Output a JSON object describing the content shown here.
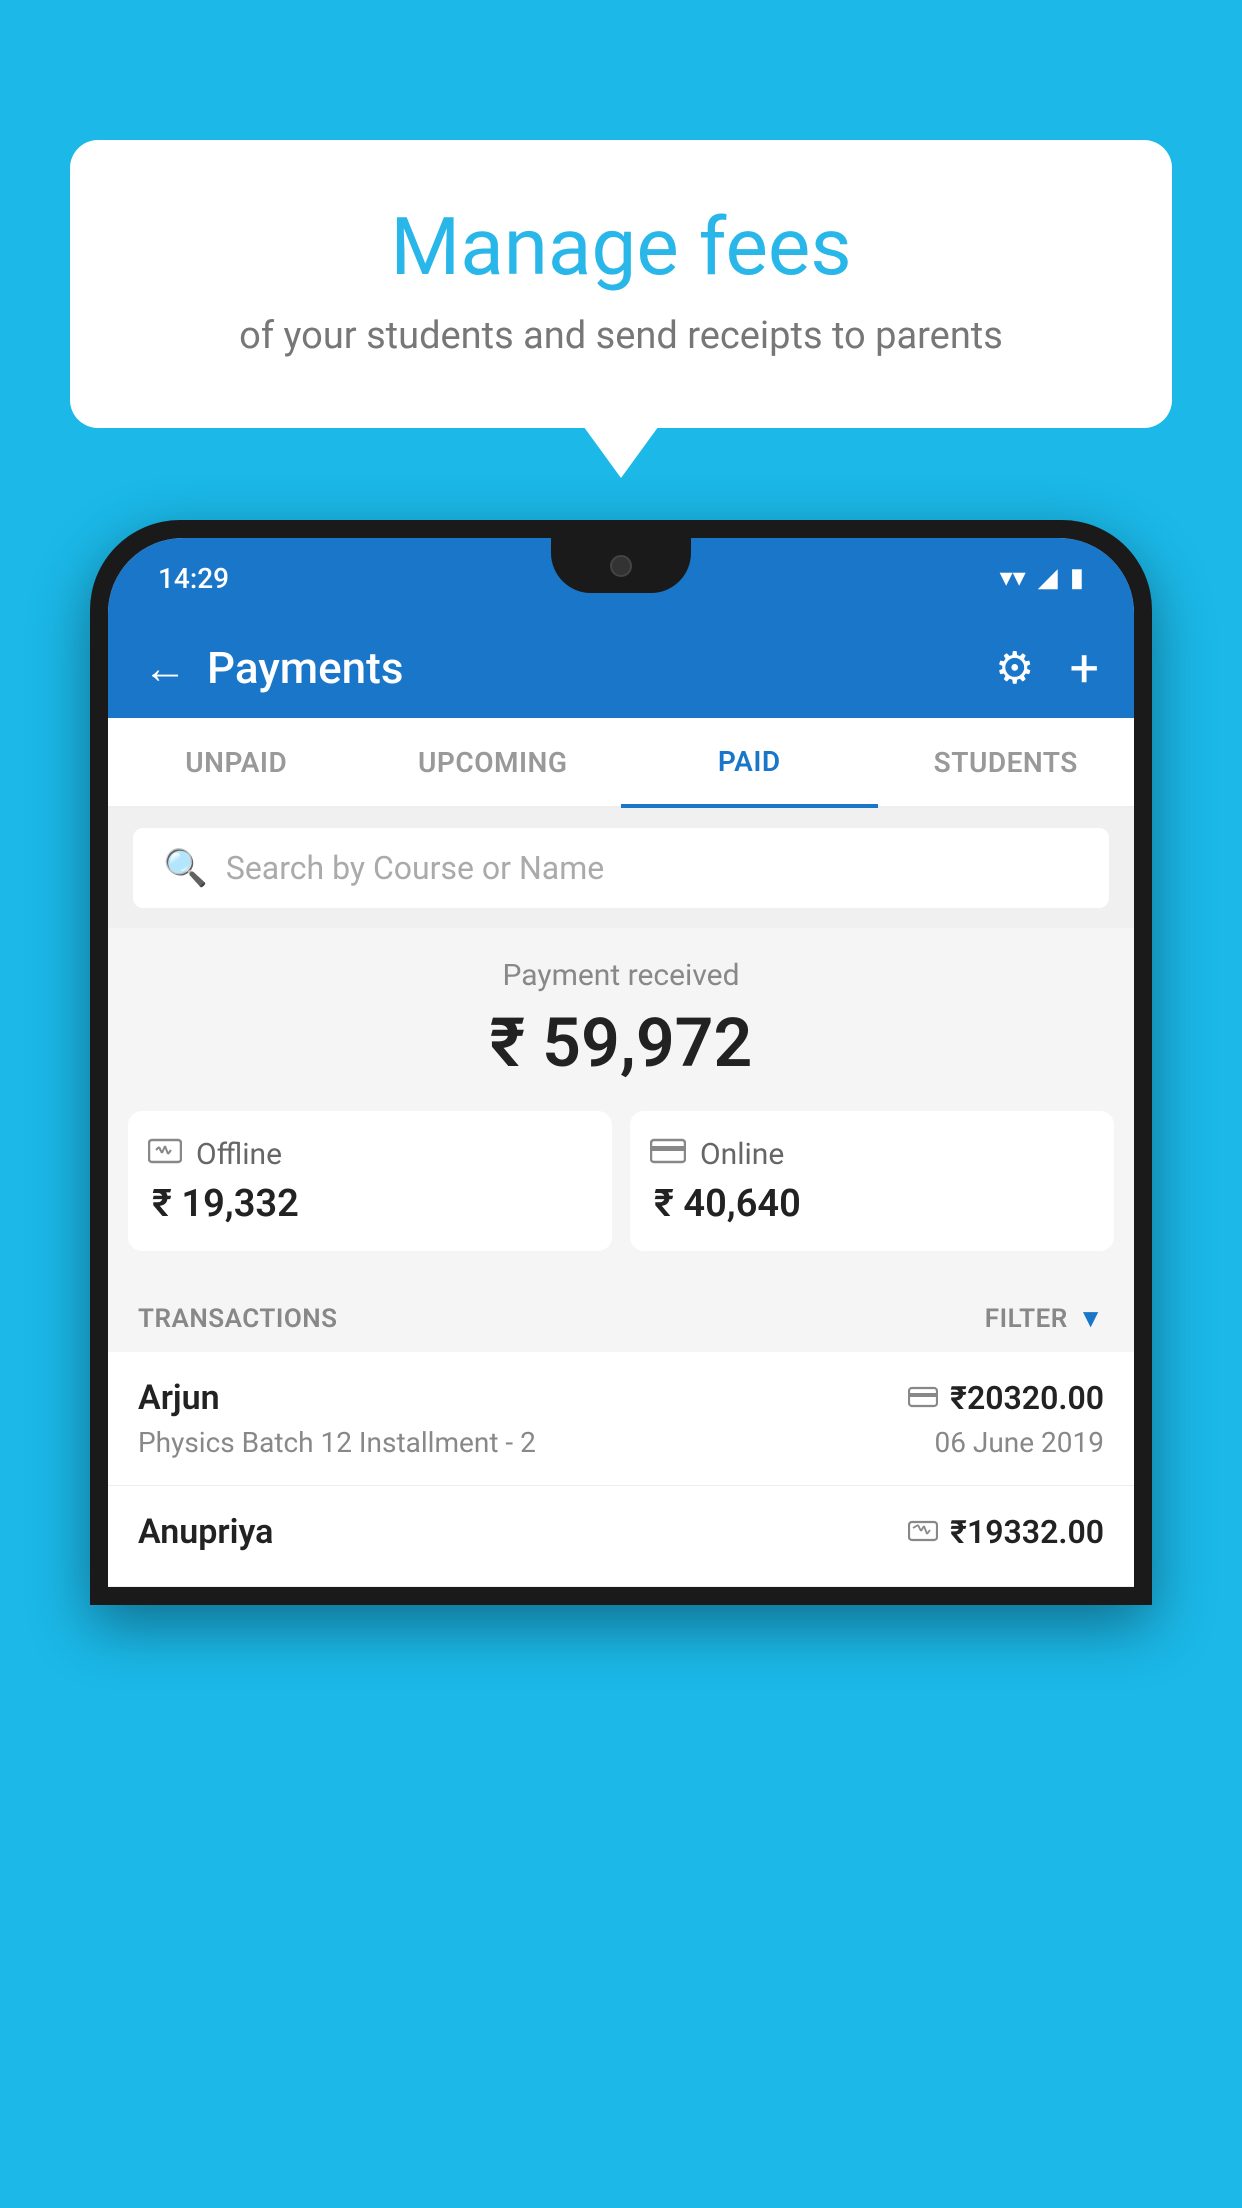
{
  "background_color": "#1BB8E8",
  "speech_bubble": {
    "title": "Manage fees",
    "subtitle": "of your students and send receipts to parents"
  },
  "phone": {
    "status_bar": {
      "time": "14:29",
      "wifi": "▾",
      "signal": "▲",
      "battery": "▮"
    },
    "header": {
      "back_label": "←",
      "title": "Payments",
      "gear_label": "⚙",
      "plus_label": "+"
    },
    "tabs": [
      {
        "label": "UNPAID",
        "active": false
      },
      {
        "label": "UPCOMING",
        "active": false
      },
      {
        "label": "PAID",
        "active": true
      },
      {
        "label": "STUDENTS",
        "active": false
      }
    ],
    "search": {
      "placeholder": "Search by Course or Name"
    },
    "payment_received": {
      "label": "Payment received",
      "total": "₹ 59,972",
      "offline_label": "Offline",
      "offline_amount": "₹ 19,332",
      "online_label": "Online",
      "online_amount": "₹ 40,640"
    },
    "transactions": {
      "header_label": "TRANSACTIONS",
      "filter_label": "FILTER",
      "rows": [
        {
          "name": "Arjun",
          "course": "Physics Batch 12 Installment - 2",
          "amount": "₹20320.00",
          "date": "06 June 2019",
          "icon": "card"
        },
        {
          "name": "Anupriya",
          "course": "",
          "amount": "₹19332.00",
          "date": "",
          "icon": "cash"
        }
      ]
    }
  }
}
